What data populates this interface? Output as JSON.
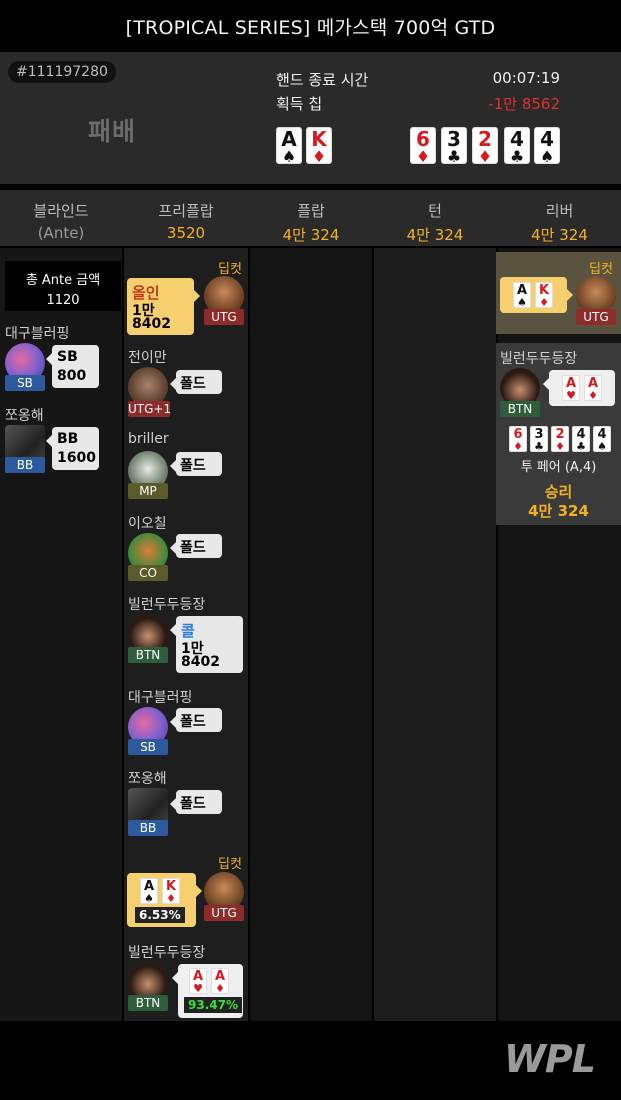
{
  "title": "[TROPICAL SERIES] 메가스택 700억 GTD",
  "summary": {
    "hand_id": "#111197280",
    "result": "패배",
    "end_time_label": "핸드 종료 시간",
    "end_time_value": "00:07:19",
    "chips_label": "획득 칩",
    "chips_value": "-1만 8562",
    "hole_cards": [
      {
        "rank": "A",
        "suit": "♠",
        "color": "black"
      },
      {
        "rank": "K",
        "suit": "♦",
        "color": "red"
      }
    ],
    "board_cards": [
      {
        "rank": "6",
        "suit": "♦",
        "color": "red"
      },
      {
        "rank": "3",
        "suit": "♣",
        "color": "black"
      },
      {
        "rank": "2",
        "suit": "♦",
        "color": "red"
      },
      {
        "rank": "4",
        "suit": "♣",
        "color": "black"
      },
      {
        "rank": "4",
        "suit": "♠",
        "color": "black"
      }
    ]
  },
  "streets": [
    {
      "name": "블라인드",
      "sub": "(Ante)"
    },
    {
      "name": "프리플랍",
      "amount": "3520"
    },
    {
      "name": "플랍",
      "amount": "4만 324"
    },
    {
      "name": "턴",
      "amount": "4만 324"
    },
    {
      "name": "리버",
      "amount": "4만 324"
    }
  ],
  "blinds": {
    "ante_label": "총 Ante 금액",
    "ante_value": "1120",
    "players": [
      {
        "name": "대구블러핑",
        "pos": "SB",
        "action": "SB",
        "amount": "800"
      },
      {
        "name": "쪼옹해",
        "pos": "BB",
        "action": "BB",
        "amount": "1600"
      }
    ]
  },
  "preflop": {
    "hero_tag": "딥컷",
    "hero_pos": "UTG",
    "hero_action": "올인",
    "hero_amount_1": "1만",
    "hero_amount_2": "8402",
    "actions": [
      {
        "name": "전이만",
        "pos": "UTG+1",
        "action": "폴드"
      },
      {
        "name": "briller",
        "pos": "MP",
        "action": "폴드"
      },
      {
        "name": "이오칠",
        "pos": "CO",
        "action": "폴드"
      },
      {
        "name": "빌런두두등장",
        "pos": "BTN",
        "action": "콜",
        "amount_1": "1만",
        "amount_2": "8402"
      },
      {
        "name": "대구블러핑",
        "pos": "SB",
        "action": "폴드"
      },
      {
        "name": "쪼옹해",
        "pos": "BB",
        "action": "폴드"
      }
    ],
    "showdown_hero_tag": "딥컷",
    "showdown_hero_pos": "UTG",
    "showdown_hero_pct": "6.53%",
    "showdown_villain_name": "빌런두두등장",
    "showdown_villain_pos": "BTN",
    "showdown_villain_pct": "93.47%",
    "villain_cards": [
      {
        "rank": "A",
        "suit": "♥",
        "color": "red"
      },
      {
        "rank": "A",
        "suit": "♦",
        "color": "red"
      }
    ]
  },
  "river": {
    "hero_tag": "딥컷",
    "hero_pos": "UTG",
    "winner_name": "빌런두두등장",
    "winner_pos": "BTN",
    "hand_rank": "투 페어 (A,4)",
    "win_label": "승리",
    "win_amount": "4만 324"
  },
  "footer": {
    "logo": "WPL"
  }
}
